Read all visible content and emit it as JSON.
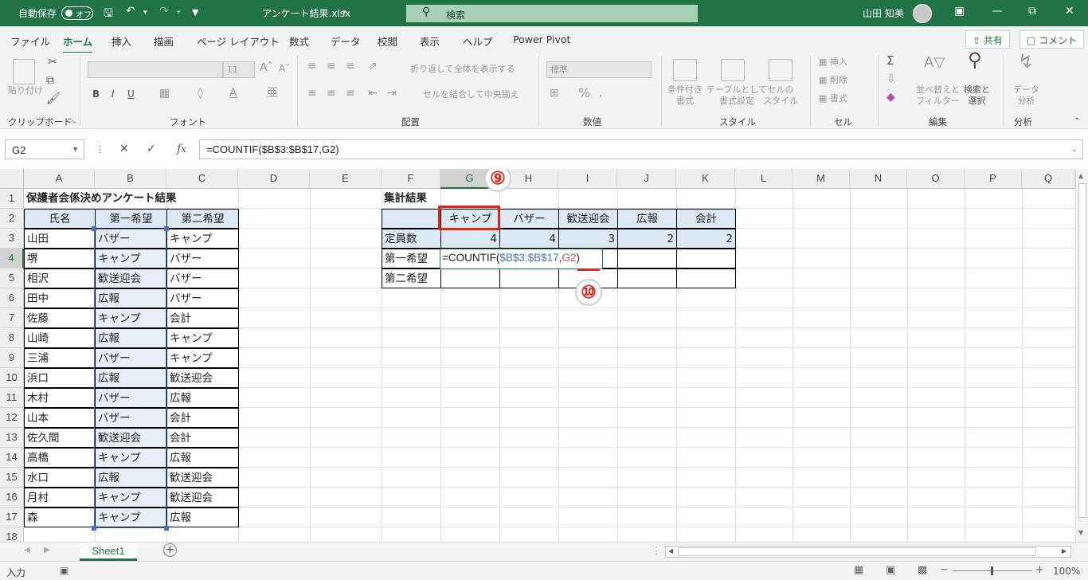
{
  "title_bar": {
    "autosave_label": "自動保存",
    "autosave_state": "オフ",
    "filename": "アンケート結果.xlsx",
    "search_placeholder": "検索",
    "user_name": "山田 知美"
  },
  "tabs": [
    "ファイル",
    "ホーム",
    "挿入",
    "描画",
    "ページ レイアウト",
    "数式",
    "データ",
    "校閲",
    "表示",
    "ヘルプ",
    "Power Pivot"
  ],
  "active_tab": "ホーム",
  "share_label": "共有",
  "comment_label": "コメント",
  "ribbon": {
    "clipboard": {
      "label": "クリップボード",
      "paste": "貼り付け"
    },
    "font": {
      "label": "フォント",
      "size": "11",
      "bold": "B",
      "italic": "I",
      "underline": "U"
    },
    "alignment": {
      "label": "配置",
      "wrap": "折り返して全体を表示する",
      "merge": "セルを結合して中央揃え"
    },
    "number": {
      "label": "数値",
      "format": "標準"
    },
    "styles": {
      "label": "スタイル",
      "cond_1": "条件付き",
      "cond_2": "書式",
      "table_1": "テーブルとして",
      "table_2": "書式設定",
      "cell_1": "セルの",
      "cell_2": "スタイル"
    },
    "cells": {
      "label": "セル",
      "insert": "挿入",
      "delete": "削除",
      "format": "書式"
    },
    "editing": {
      "label": "編集",
      "sort_1": "並べ替えと",
      "sort_2": "フィルター",
      "find_1": "検索と",
      "find_2": "選択"
    },
    "analysis": {
      "label": "分析",
      "data_1": "データ",
      "data_2": "分析"
    }
  },
  "formula_bar": {
    "name_box": "G2",
    "formula": "=COUNTIF($B$3:$B$17,G2)"
  },
  "columns": [
    "A",
    "B",
    "C",
    "D",
    "E",
    "F",
    "G",
    "H",
    "I",
    "J",
    "K",
    "L",
    "M",
    "N",
    "O",
    "P",
    "Q"
  ],
  "rows": [
    "1",
    "2",
    "3",
    "4",
    "5",
    "6",
    "7",
    "8",
    "9",
    "10",
    "11",
    "12",
    "13",
    "14",
    "15",
    "16",
    "17",
    "18"
  ],
  "sheet": {
    "title": "保護者会係決めアンケート結果",
    "headers": [
      "氏名",
      "第一希望",
      "第二希望"
    ],
    "data": [
      [
        "山田",
        "バザー",
        "キャンプ"
      ],
      [
        "堺",
        "キャンプ",
        "バザー"
      ],
      [
        "相沢",
        "歓送迎会",
        "バザー"
      ],
      [
        "田中",
        "広報",
        "バザー"
      ],
      [
        "佐藤",
        "キャンプ",
        "会計"
      ],
      [
        "山崎",
        "広報",
        "キャンプ"
      ],
      [
        "三浦",
        "バザー",
        "キャンプ"
      ],
      [
        "浜口",
        "広報",
        "歓送迎会"
      ],
      [
        "木村",
        "バザー",
        "広報"
      ],
      [
        "山本",
        "バザー",
        "会計"
      ],
      [
        "佐久間",
        "歓送迎会",
        "会計"
      ],
      [
        "高橋",
        "キャンプ",
        "広報"
      ],
      [
        "水口",
        "広報",
        "歓送迎会"
      ],
      [
        "月村",
        "キャンプ",
        "歓送迎会"
      ],
      [
        "森",
        "キャンプ",
        "広報"
      ]
    ],
    "summary_title": "集計結果",
    "summary_headers": [
      "キャンプ",
      "バザー",
      "歓送迎会",
      "広報",
      "会計"
    ],
    "summary_rows": [
      {
        "label": "定員数",
        "values": [
          "4",
          "4",
          "3",
          "2",
          "2"
        ]
      },
      {
        "label": "第一希望",
        "values": [
          "",
          "",
          "",
          "",
          ""
        ]
      },
      {
        "label": "第二希望",
        "values": [
          "",
          "",
          "",
          "",
          ""
        ]
      }
    ],
    "editing_formula": {
      "prefix": "=COUNTIF(",
      "range": "$B$3:$B$17",
      "comma": ",",
      "criteria": "G2",
      "suffix": ")"
    }
  },
  "annotations": {
    "step9": "⑨",
    "step10": "⑩"
  },
  "sheet_tab": "Sheet1",
  "status": {
    "mode": "入力",
    "zoom": "100%"
  },
  "colors": {
    "excel_green": "#217346",
    "header_fill": "#dde8f5",
    "highlight_red": "#e0251b",
    "range_blue": "#4472c4"
  }
}
